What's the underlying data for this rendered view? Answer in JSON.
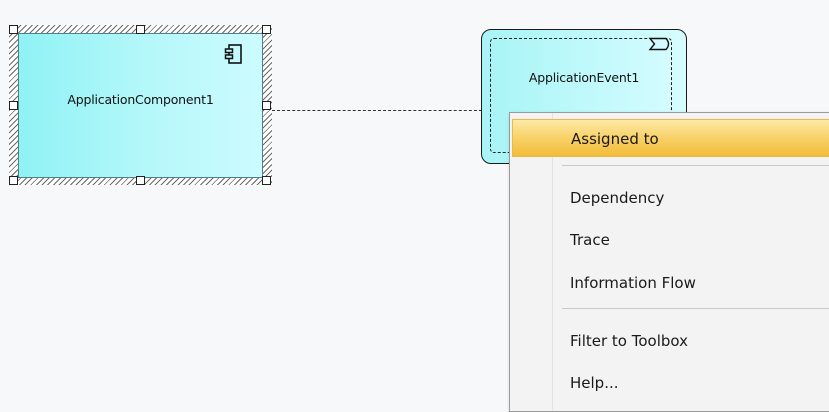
{
  "diagram": {
    "elements": [
      {
        "type": "application-component",
        "label": "ApplicationComponent1",
        "selected": true,
        "icon": "component-icon"
      },
      {
        "type": "application-event",
        "label": "ApplicationEvent1",
        "icon": "event-icon"
      }
    ],
    "connector": {
      "style": "dashed",
      "from": "ApplicationComponent1",
      "to": "ApplicationEvent1"
    }
  },
  "context_menu": {
    "items": [
      {
        "label": "Assigned to",
        "highlighted": true
      },
      {
        "label": "Dependency"
      },
      {
        "label": "Trace"
      },
      {
        "label": "Information Flow"
      },
      {
        "label": "Filter to Toolbox"
      },
      {
        "label": "Help..."
      }
    ]
  },
  "colors": {
    "element_fill": "#b6f8fa",
    "highlight": "#f8cf62",
    "menu_background": "#f3f3f3"
  }
}
